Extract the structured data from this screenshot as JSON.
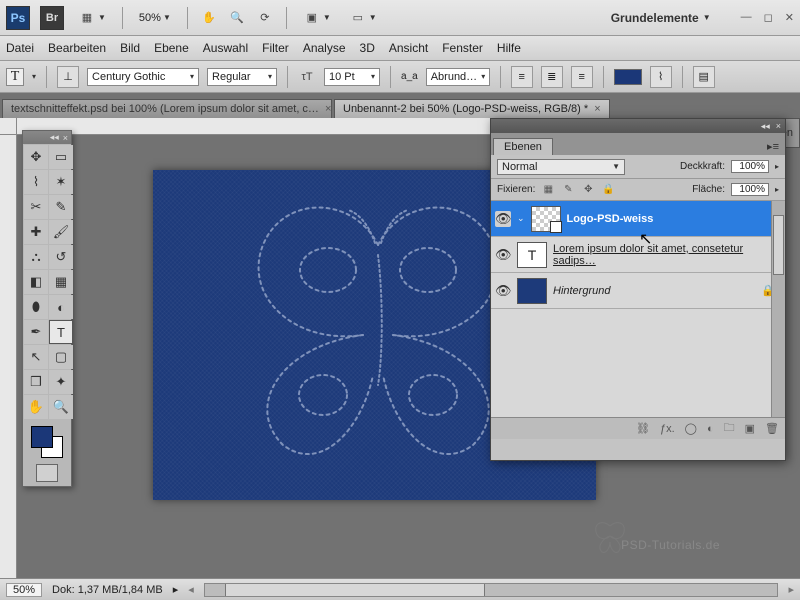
{
  "titlebar": {
    "zoom": "50%",
    "workspace": "Grundelemente"
  },
  "menu": [
    "Datei",
    "Bearbeiten",
    "Bild",
    "Ebene",
    "Auswahl",
    "Filter",
    "Analyse",
    "3D",
    "Ansicht",
    "Fenster",
    "Hilfe"
  ],
  "options": {
    "font": "Century Gothic",
    "style": "Regular",
    "size": "10 Pt",
    "aa_prefix": "a_a",
    "aa": "Abrund…"
  },
  "tabs": [
    {
      "label": "textschnitteffekt.psd bei 100% (Lorem ipsum dolor sit amet, c…",
      "active": false
    },
    {
      "label": "Unbenannt-2 bei 50% (Logo-PSD-weiss, RGB/8) *",
      "active": true
    }
  ],
  "rdock": {
    "label": "Masken"
  },
  "layersPanel": {
    "tab": "Ebenen",
    "mode": "Normal",
    "opacityLabel": "Deckkraft:",
    "opacity": "100%",
    "lockLabel": "Fixieren:",
    "fillLabel": "Fläche:",
    "fill": "100%",
    "layers": [
      {
        "name": "Logo-PSD-weiss",
        "kind": "smart",
        "selected": true
      },
      {
        "name": "Lorem ipsum dolor sit amet, consetetur sadips…",
        "kind": "text",
        "selected": false
      },
      {
        "name": "Hintergrund",
        "kind": "bg",
        "selected": false,
        "locked": true
      }
    ],
    "footIcons": [
      "link",
      "fx",
      "mask",
      "adjust",
      "group",
      "new",
      "trash"
    ]
  },
  "status": {
    "zoom": "50%",
    "doc": "Dok: 1,37 MB/1,84 MB"
  },
  "watermark": "PSD-Tutorials.de"
}
